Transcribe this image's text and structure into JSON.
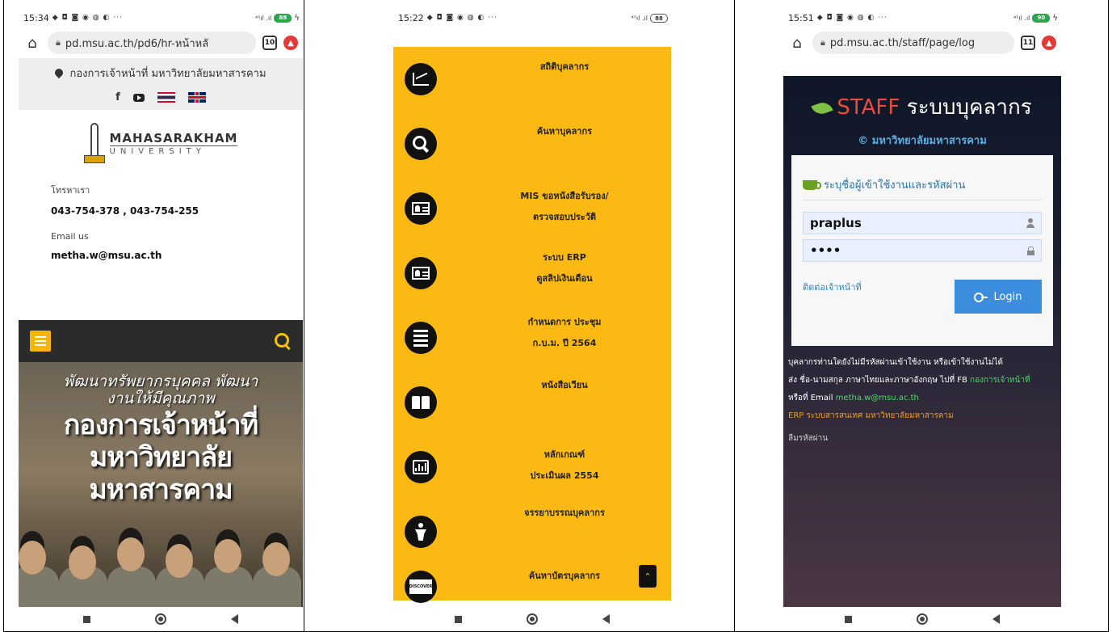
{
  "panel1": {
    "status": {
      "time": "15:34",
      "icons": "◆ ◘ ◙ ◉ ◍ ◐ ···",
      "signal": "⁴⁵ıl .ıl",
      "battery": "88"
    },
    "url": "pd.msu.ac.th/pd6/hr-หน้าหลั",
    "tabs": "10",
    "address": "กองการเจ้าหน้าที่ มหาวิทยาลัยมหาสารคาม",
    "facebook_glyph": "f",
    "logo": {
      "main": "MAHASARAKHAM",
      "sub": "UNIVERSITY"
    },
    "contact": {
      "phone_label": "โทรหาเรา",
      "phone_value": "043-754-378 , 043-754-255",
      "email_label": "Email us",
      "email_value": "metha.w@msu.ac.th"
    },
    "hero": {
      "line1a": "พัฒนาทรัพยากรบุคคล พัฒนา",
      "line1b": "งานให้มีคุณภาพ",
      "line2a": "กองการเจ้าหน้าที่",
      "line2b": "มหาวิทยาลัย",
      "line2c": "มหาสารคาม"
    }
  },
  "panel2": {
    "status": {
      "time": "15:22",
      "icons": "◆ ◘ ◙ ◉ ◍ ◐ ···",
      "signal": "⁴⁵ıl .ıl",
      "battery": "88"
    },
    "menu": [
      {
        "label1": "สถิติบุคลากร",
        "label2": "",
        "icon": "chart-line-icon"
      },
      {
        "label1": "ค้นหาบุคลากร",
        "label2": "",
        "icon": "search-icon"
      },
      {
        "label1": "MIS ขอหนังสือรับรอง/",
        "label2": "ตรวจสอบประวัติ",
        "icon": "id-card-icon"
      },
      {
        "label1": "ระบบ ERP",
        "label2": "ดูสลิปเงินเดือน",
        "icon": "id-card-icon"
      },
      {
        "label1": "กำหนดการ ประชุม",
        "label2": "ก.บ.ม. ปี 2564",
        "icon": "list-icon"
      },
      {
        "label1": "หนังสือเวียน",
        "label2": "",
        "icon": "book-icon"
      },
      {
        "label1": "หลักเกณฑ์",
        "label2": "ประเมินผล 2554",
        "icon": "bar-chart-icon"
      },
      {
        "label1": "จรรยาบรรณบุคลากร",
        "label2": "",
        "icon": "person-icon"
      },
      {
        "label1": "ค้นหาบัตรบุคลากร",
        "label2": "",
        "icon": "discover-card-icon"
      }
    ],
    "discover_text": "DISCOVER",
    "scroll_top_glyph": "⌃"
  },
  "panel3": {
    "status": {
      "time": "15:51",
      "icons": "◆ ◘ ◙ ◉ ◍ ◐ ···",
      "signal": "⁴⁵ıl .ıl",
      "battery": "90"
    },
    "url": "pd.msu.ac.th/staff/page/log",
    "tabs": "11",
    "brand_staff": "STAFF",
    "brand_rest": " ระบบบุคลากร",
    "subtitle": "© มหาวิทยาลัยมหาสารคาม",
    "card_title": "ระบุชื่อผู้เข้าใช้งานและรหัสผ่าน",
    "username": "praplus",
    "password": "••••",
    "contact_link": "ติดต่อเจ้าหน้าที่",
    "login_label": "Login",
    "info_line1": "บุคลากรท่านใดยังไม่มีรหัสผ่านเข้าใช้งาน หรือเข้าใช้งานไม่ได้",
    "info_line2_prefix": "ส่ง ชื่อ-นามสกุล ภาษาไทยและภาษาอังกฤษ ไปที่ FB ",
    "info_line2_link": "กองการเจ้าหน้าที่",
    "info_line3_prefix": "หรือที่ Email ",
    "info_line3_link": "metha.w@msu.ac.th",
    "info_line4": "ERP ระบบสารสนเทศ มหาวิทยาลัยมหาสารคาม",
    "forgot": "ลืมรหัสผ่าน"
  }
}
